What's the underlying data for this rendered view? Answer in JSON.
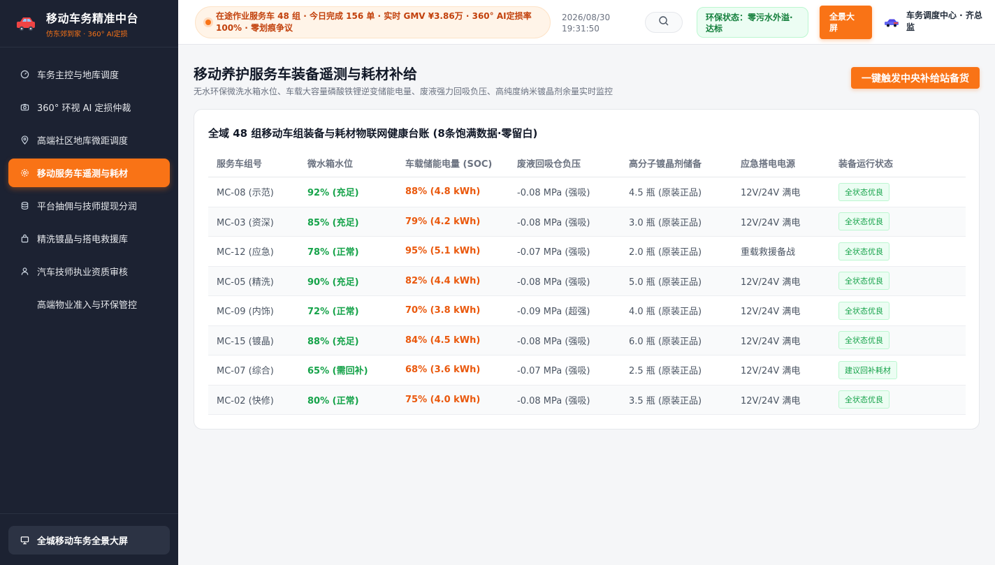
{
  "brand": {
    "title": "移动车务精准中台",
    "subtitle": "仿东郊到家 · 360° AI定损"
  },
  "sidebar": {
    "items": [
      {
        "label": "车务主控与地库调度",
        "icon": "dashboard-icon",
        "active": false
      },
      {
        "label": "360° 环视 AI 定损仲裁",
        "icon": "camera-icon",
        "active": false
      },
      {
        "label": "高端社区地库微距调度",
        "icon": "location-pin-icon",
        "active": false
      },
      {
        "label": "移动服务车遥测与耗材",
        "icon": "gear-icon",
        "active": true
      },
      {
        "label": "平台抽佣与技师提现分润",
        "icon": "database-icon",
        "active": false
      },
      {
        "label": "精洗镀晶与搭电救援库",
        "icon": "bag-icon",
        "active": false
      },
      {
        "label": "汽车技师执业资质审核",
        "icon": "user-icon",
        "active": false
      },
      {
        "label": "高端物业准入与环保管控",
        "icon": "",
        "active": false
      }
    ],
    "bottom_label": "全城移动车务全景大屏"
  },
  "header": {
    "ticker": "在途作业服务车 48 组 · 今日完成 156 单 · 实时 GMV ¥3.86万 · 360° AI定损率 100% · 零划痕争议",
    "date": "2026/08/30",
    "time": "19:31:50",
    "env_status": "环保状态：零污水外溢·达标",
    "screen_button": "全景大屏",
    "user_name": "车务调度中心 · 齐总监"
  },
  "page": {
    "title": "移动养护服务车装备遥测与耗材补给",
    "subtitle": "无水环保微洗水箱水位、车载大容量磷酸铁锂逆变储能电量、废液强力回吸负压、高纯度纳米镀晶剂余量实时监控",
    "restock_button": "一键触发中央补给站备货"
  },
  "ledger": {
    "title": "全域 48 组移动车组装备与耗材物联网健康台账 (8条饱满数据·零留白)",
    "columns": [
      "服务车组号",
      "微水箱水位",
      "车载储能电量 (SOC)",
      "废液回吸仓负压",
      "高分子镀晶剂储备",
      "应急搭电电源",
      "装备运行状态"
    ],
    "rows": [
      {
        "id": "MC-08 (示范)",
        "water": "92% (充足)",
        "soc": "88% (4.8 kWh)",
        "vacuum": "-0.08 MPa (强吸)",
        "coating": "4.5 瓶 (原装正品)",
        "power": "12V/24V 满电",
        "status": "全状态优良"
      },
      {
        "id": "MC-03 (资深)",
        "water": "85% (充足)",
        "soc": "79% (4.2 kWh)",
        "vacuum": "-0.08 MPa (强吸)",
        "coating": "3.0 瓶 (原装正品)",
        "power": "12V/24V 满电",
        "status": "全状态优良"
      },
      {
        "id": "MC-12 (应急)",
        "water": "78% (正常)",
        "soc": "95% (5.1 kWh)",
        "vacuum": "-0.07 MPa (强吸)",
        "coating": "2.0 瓶 (原装正品)",
        "power": "重载救援备战",
        "status": "全状态优良"
      },
      {
        "id": "MC-05 (精洗)",
        "water": "90% (充足)",
        "soc": "82% (4.4 kWh)",
        "vacuum": "-0.08 MPa (强吸)",
        "coating": "5.0 瓶 (原装正品)",
        "power": "12V/24V 满电",
        "status": "全状态优良"
      },
      {
        "id": "MC-09 (内饰)",
        "water": "72% (正常)",
        "soc": "70% (3.8 kWh)",
        "vacuum": "-0.09 MPa (超强)",
        "coating": "4.0 瓶 (原装正品)",
        "power": "12V/24V 满电",
        "status": "全状态优良"
      },
      {
        "id": "MC-15 (镀晶)",
        "water": "88% (充足)",
        "soc": "84% (4.5 kWh)",
        "vacuum": "-0.08 MPa (强吸)",
        "coating": "6.0 瓶 (原装正品)",
        "power": "12V/24V 满电",
        "status": "全状态优良"
      },
      {
        "id": "MC-07 (综合)",
        "water": "65% (需回补)",
        "soc": "68% (3.6 kWh)",
        "vacuum": "-0.07 MPa (强吸)",
        "coating": "2.5 瓶 (原装正品)",
        "power": "12V/24V 满电",
        "status": "建议回补耗材"
      },
      {
        "id": "MC-02 (快修)",
        "water": "80% (正常)",
        "soc": "75% (4.0 kWh)",
        "vacuum": "-0.08 MPa (强吸)",
        "coating": "3.5 瓶 (原装正品)",
        "power": "12V/24V 满电",
        "status": "全状态优良"
      }
    ]
  },
  "colors": {
    "accent": "#f97316",
    "sidebar_bg": "#1c2232",
    "good": "#16a34a",
    "energy": "#ea580c"
  }
}
